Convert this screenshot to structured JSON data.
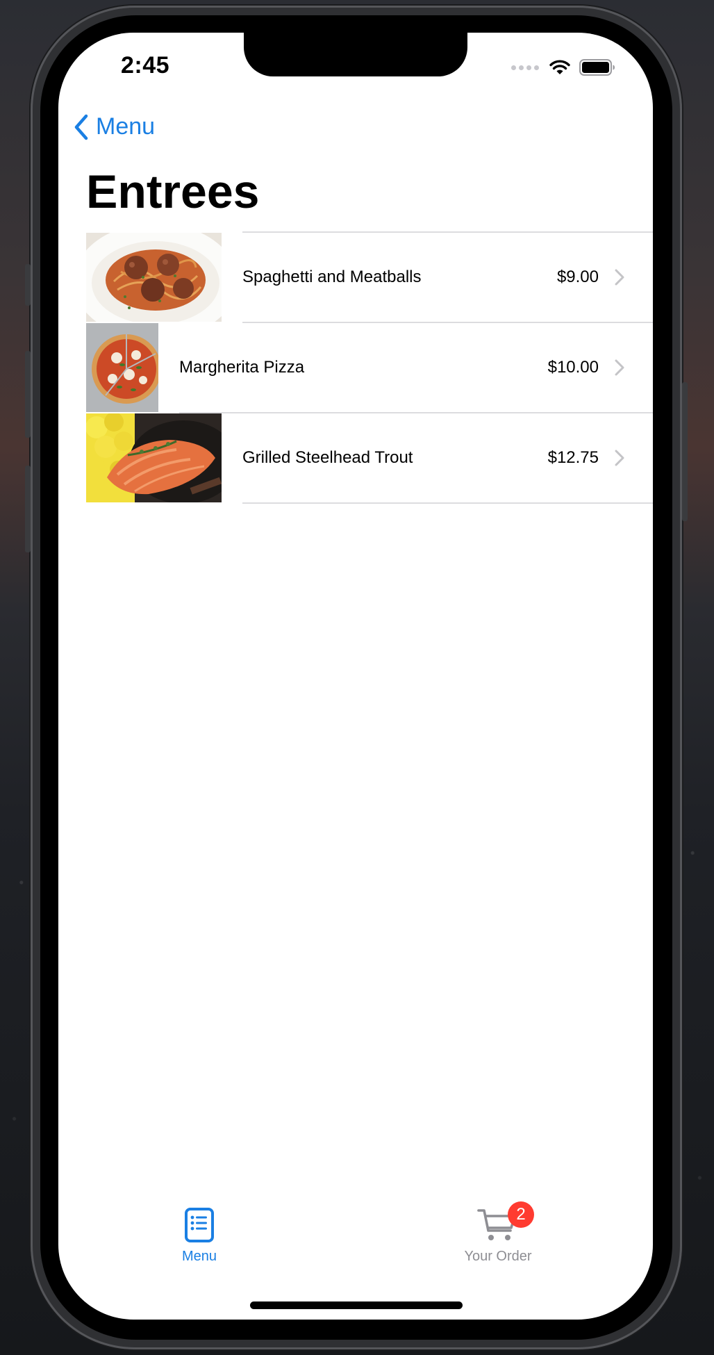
{
  "status_bar": {
    "time": "2:45"
  },
  "nav": {
    "back_label": "Menu"
  },
  "page": {
    "title": "Entrees"
  },
  "entrees": [
    {
      "name": "Spaghetti and Meatballs",
      "price": "$9.00",
      "image": "spaghetti-meatballs-photo"
    },
    {
      "name": "Margherita Pizza",
      "price": "$10.00",
      "image": "margherita-pizza-photo"
    },
    {
      "name": "Grilled Steelhead Trout",
      "price": "$12.75",
      "image": "grilled-trout-photo"
    }
  ],
  "tab_bar": {
    "menu_label": "Menu",
    "order_label": "Your Order",
    "order_badge": "2"
  },
  "colors": {
    "accent": "#1A7FE3",
    "inactive": "#8E8E93",
    "badge": "#FF3B30",
    "separator": "#DCDCDF"
  },
  "icons": {
    "back": "chevron-left-icon",
    "row_disclosure": "chevron-right-icon",
    "menu_tab": "list-icon",
    "order_tab": "cart-icon",
    "wifi": "wifi-icon",
    "battery": "battery-icon",
    "signal": "signal-dots-icon"
  }
}
